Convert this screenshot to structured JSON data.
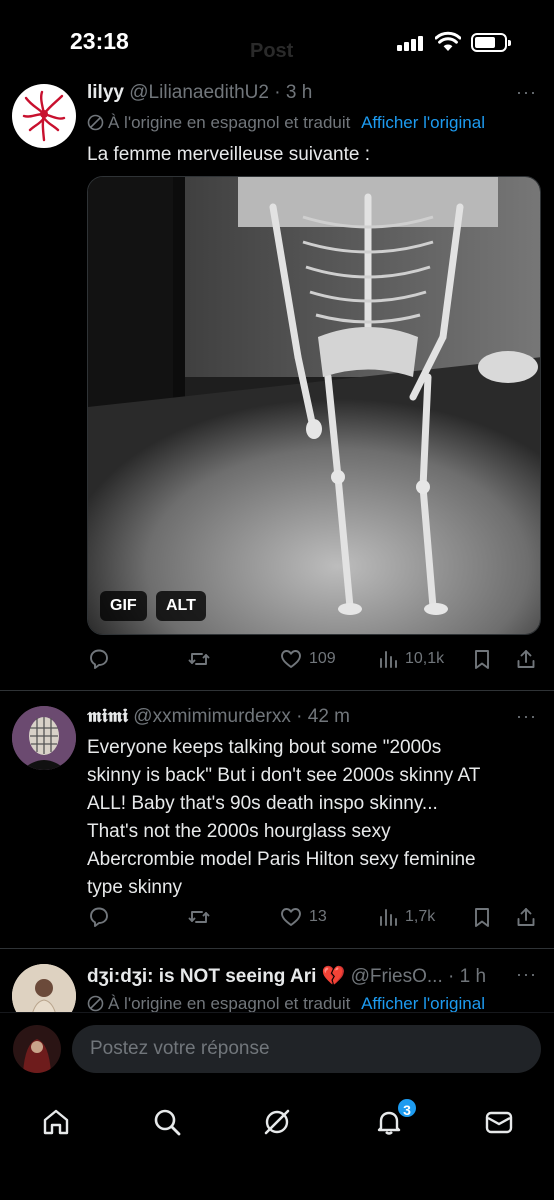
{
  "status_bar": {
    "time": "23:18",
    "faded_title": "Post"
  },
  "tweets": [
    {
      "display_name": "lilyy",
      "handle": "@LilianaedithU2",
      "separator": "·",
      "time_ago": "3 h",
      "more": "···",
      "translation_note": "À l'origine en espagnol et traduit",
      "show_original": "Afficher l'original",
      "text": "La femme merveilleuse suivante :",
      "media_type": "gif",
      "media_badges": {
        "gif": "GIF",
        "alt": "ALT"
      },
      "stats": {
        "replies": "",
        "reposts": "",
        "likes": "109",
        "views": "10,1k"
      }
    },
    {
      "display_name": "𝖒𝖎𝖒𝖎",
      "handle": "@xxmimimurderxx",
      "separator": "·",
      "time_ago": "42 m",
      "more": "···",
      "text_lines": [
        "Everyone keeps talking bout some \"2000s",
        "skinny is back\" But i don't see 2000s skinny AT",
        "ALL! Baby that's 90s death inspo skinny...",
        "That's not the 2000s hourglass sexy",
        "Abercrombie model Paris Hilton sexy feminine",
        "type skinny"
      ],
      "stats": {
        "replies": "",
        "reposts": "",
        "likes": "13",
        "views": "1,7k"
      }
    },
    {
      "display_name": "dʒi:dʒi: is NOT seeing Ari 💔",
      "handle": "@FriesO...",
      "separator": "·",
      "time_ago": "1 h",
      "more": "···",
      "translation_note": "À l'origine en espagnol et traduit",
      "show_original": "Afficher l'original"
    }
  ],
  "reply_bar": {
    "placeholder": "Postez votre réponse"
  },
  "bottom_nav": {
    "items": [
      "home-icon",
      "search-icon",
      "grok-icon",
      "notifications-icon",
      "messages-icon"
    ],
    "notification_count": "3"
  },
  "colors": {
    "accent": "#1d9bf0",
    "muted": "#71767b",
    "background": "#000000",
    "divider": "#2f3336"
  }
}
